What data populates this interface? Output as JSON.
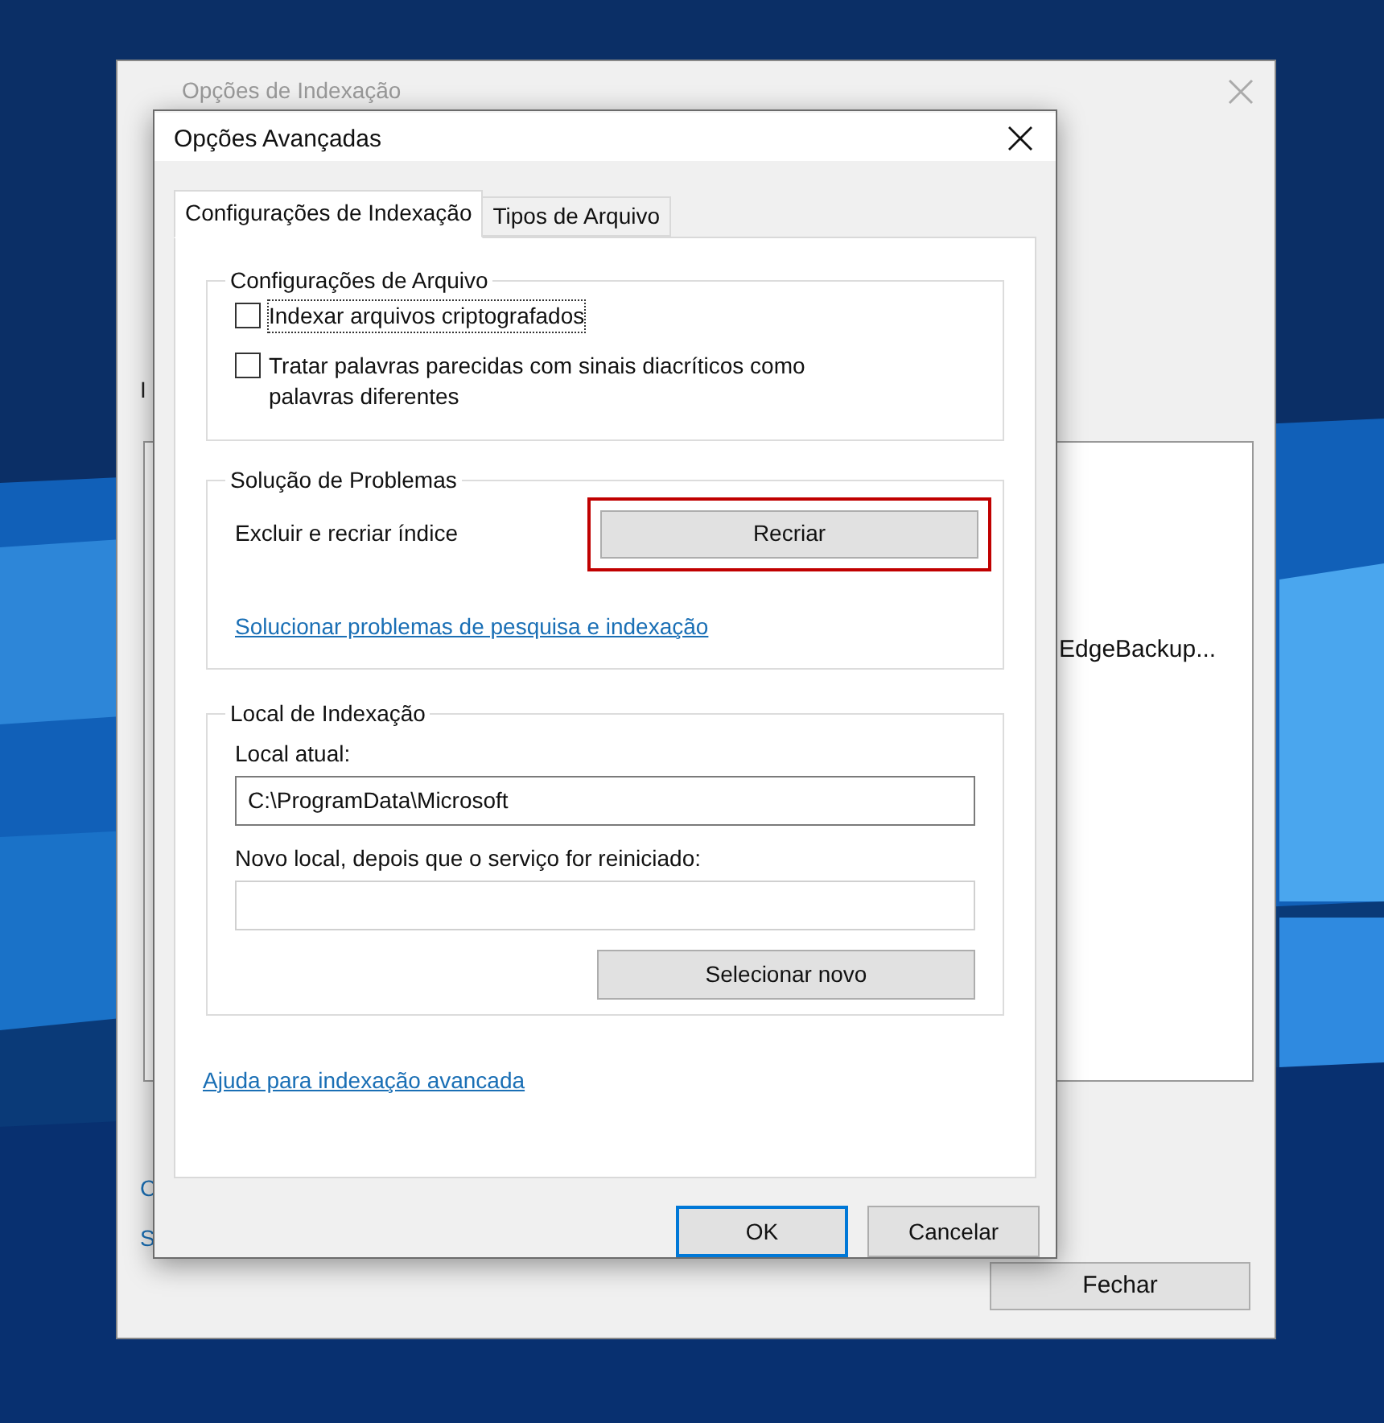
{
  "back_window": {
    "title": "Opções de Indexação",
    "list_text": "EdgeBackup...",
    "cut_texts": [
      "I",
      "C",
      "S"
    ],
    "close_button": "Fechar"
  },
  "dialog": {
    "title": "Opções Avançadas",
    "tabs": [
      {
        "label": "Configurações de Indexação",
        "selected": true
      },
      {
        "label": "Tipos de Arquivo",
        "selected": false
      }
    ],
    "file_settings": {
      "title": "Configurações de Arquivo",
      "options": [
        {
          "label": "Indexar arquivos criptografados",
          "checked": false,
          "focused": true
        },
        {
          "label": "Tratar palavras parecidas com sinais diacríticos como palavras diferentes",
          "checked": false,
          "focused": false
        }
      ]
    },
    "troubleshooting": {
      "title": "Solução de Problemas",
      "label": "Excluir e recriar índice",
      "button": "Recriar",
      "button_highlighted": true,
      "link": "Solucionar problemas de pesquisa e indexação"
    },
    "location": {
      "title": "Local de Indexação",
      "current_label": "Local atual:",
      "current_value": "C:\\ProgramData\\Microsoft",
      "new_label": "Novo local, depois que o serviço for reiniciado:",
      "button": "Selecionar novo"
    },
    "help_link": "Ajuda para indexação avancada",
    "buttons": [
      {
        "label": "OK",
        "default": true
      },
      {
        "label": "Cancelar",
        "default": false
      }
    ]
  }
}
